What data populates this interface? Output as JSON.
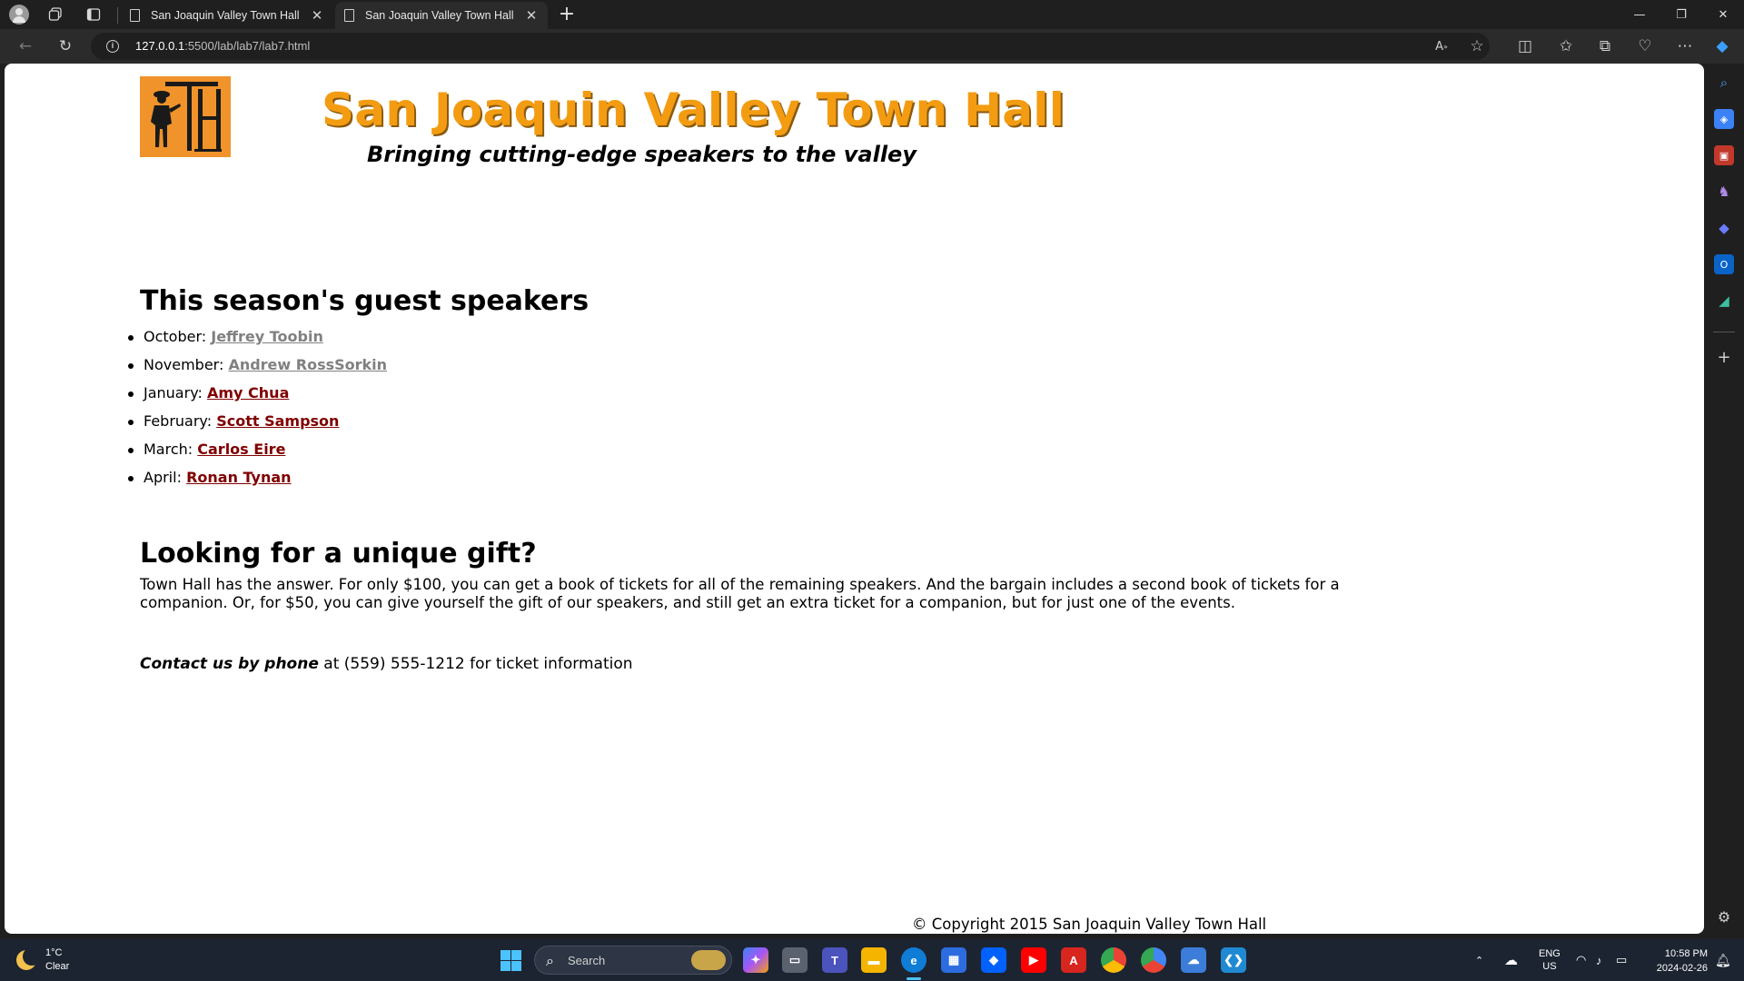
{
  "browser": {
    "tabs": [
      {
        "title": "San Joaquin Valley Town Hall",
        "active": false
      },
      {
        "title": "San Joaquin Valley Town Hall",
        "active": true
      }
    ],
    "address": {
      "host": "127.0.0.1",
      "path": ":5500/lab/lab7/lab7.html"
    }
  },
  "page": {
    "title": "San Joaquin Valley Town Hall",
    "tagline": "Bringing cutting-edge speakers to the valley",
    "speakers_heading": "This season's guest speakers",
    "speakers": [
      {
        "month": "October:",
        "name": "Jeffrey Toobin",
        "visited": true
      },
      {
        "month": "November:",
        "name": "Andrew RossSorkin",
        "visited": true
      },
      {
        "month": "January:",
        "name": "Amy Chua",
        "visited": false
      },
      {
        "month": "February:",
        "name": "Scott Sampson",
        "visited": false
      },
      {
        "month": "March:",
        "name": "Carlos Eire",
        "visited": false
      },
      {
        "month": "April:",
        "name": "Ronan Tynan",
        "visited": false
      }
    ],
    "gift_heading": "Looking for a unique gift?",
    "gift_text": "Town Hall has the answer. For only $100, you can get a book of tickets for all of the remaining speakers. And the bargain includes a second book of tickets for a companion. Or, for $50, you can give yourself the gift of our speakers, and still get an extra ticket for a companion, but for just one of the events.",
    "contact_lead": "Contact us by phone",
    "contact_rest": " at (559) 555-1212 for ticket information",
    "footer": "© Copyright 2015 San Joaquin Valley Town Hall",
    "title_color": "#f39c12",
    "logo_color": "#f0932a",
    "link_visited_color": "#808080",
    "link_color": "#800000"
  },
  "taskbar": {
    "weather_temp": "1°C",
    "weather_desc": "Clear",
    "search_placeholder": "Search",
    "lang_line1": "ENG",
    "lang_line2": "US",
    "time": "10:58 PM",
    "date": "2024-02-26"
  }
}
